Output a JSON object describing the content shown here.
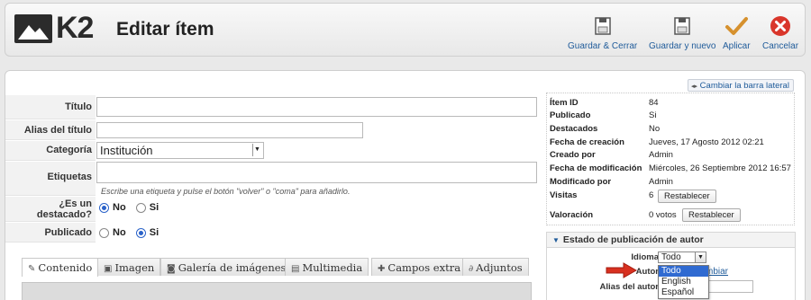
{
  "header": {
    "logo_text": "K2",
    "title": "Editar ítem",
    "toolbar": [
      {
        "label": "Guardar & Cerrar",
        "icon": "save-icon"
      },
      {
        "label": "Guardar y nuevo",
        "icon": "save-icon"
      },
      {
        "label": "Aplicar",
        "icon": "check-icon"
      },
      {
        "label": "Cancelar",
        "icon": "cancel-icon"
      }
    ]
  },
  "form": {
    "titulo_label": "Título",
    "titulo_value": "",
    "alias_label": "Alias del título",
    "alias_value": "",
    "categoria_label": "Categoría",
    "categoria_value": "Institución",
    "etiquetas_label": "Etiquetas",
    "etiquetas_hint": "Escribe una etiqueta y pulse el botón \"volver\" o \"coma\" para añadirlo.",
    "destacado_label": "¿Es un destacado?",
    "destacado_no": "No",
    "destacado_si": "Si",
    "destacado_selected": "No",
    "publicado_label": "Publicado",
    "publicado_no": "No",
    "publicado_si": "Si",
    "publicado_selected": "Si"
  },
  "tabs": [
    {
      "label": "Contenido",
      "icon": "edit-icon",
      "active": true
    },
    {
      "label": "Imagen",
      "icon": "image-icon",
      "active": false
    },
    {
      "label": "Galería de imágenes",
      "icon": "camera-icon",
      "active": false
    },
    {
      "label": "Multimedia",
      "icon": "film-icon",
      "active": false
    },
    {
      "label": "Campos extra",
      "icon": "puzzle-icon",
      "active": false
    },
    {
      "label": "Adjuntos",
      "icon": "paperclip-icon",
      "active": false
    }
  ],
  "sidebar": {
    "toggle_label": "Cambiar la barra lateral",
    "info": [
      {
        "key": "Ítem ID",
        "value": "84"
      },
      {
        "key": "Publicado",
        "value": "Si"
      },
      {
        "key": "Destacados",
        "value": "No"
      },
      {
        "key": "Fecha de creación",
        "value": "Jueves, 17 Agosto 2012 02:21"
      },
      {
        "key": "Creado por",
        "value": "Admin"
      },
      {
        "key": "Fecha de modificación",
        "value": "Miércoles, 26 Septiembre 2012 16:57"
      },
      {
        "key": "Modificado por",
        "value": "Admin"
      },
      {
        "key": "Visitas",
        "value": "6"
      },
      {
        "key": "Valoración",
        "value": "0 votos"
      }
    ],
    "reset_label": "Restablecer",
    "publish_heading": "Estado de publicación de autor",
    "idioma_label": "Idioma",
    "idioma_value": "Todo",
    "autor_label": "Autor",
    "autor_link": "mbiar",
    "alias_autor_label": "Alias del autor",
    "idioma_options": [
      "Todo",
      "English",
      "Español"
    ]
  },
  "colors": {
    "accent": "#1f5b9a",
    "selected": "#2f6ad1",
    "cancel": "#d9362b",
    "apply": "#d6912e"
  }
}
